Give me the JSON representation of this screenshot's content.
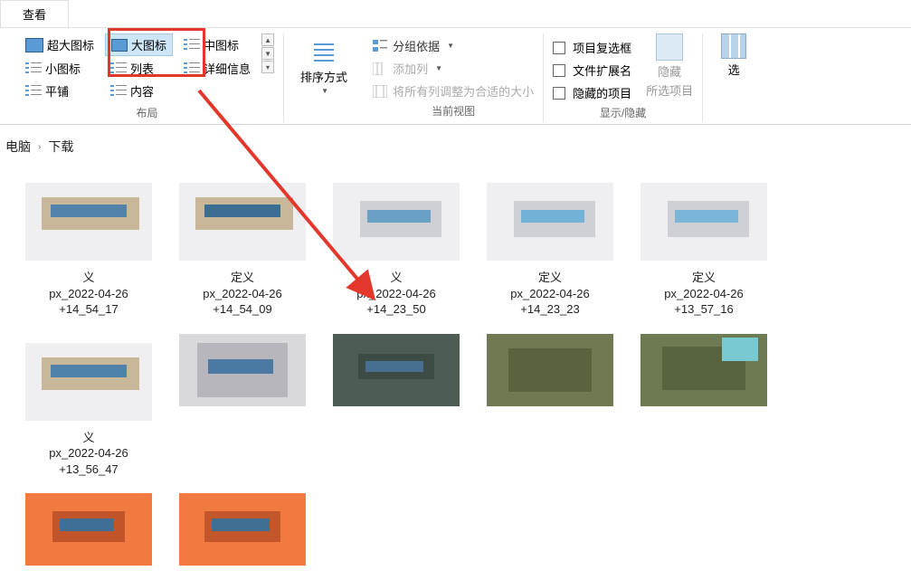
{
  "tabs": {
    "view": "查看"
  },
  "ribbon": {
    "layout": {
      "extra_large": "超大图标",
      "large": "大图标",
      "medium": "中图标",
      "small": "小图标",
      "list": "列表",
      "details": "详细信息",
      "tiles": "平铺",
      "content": "内容",
      "group_label": "布局"
    },
    "sort": {
      "label": "排序方式"
    },
    "view": {
      "group_by": "分组依据",
      "add_column": "添加列",
      "autofit": "将所有列调整为合适的大小",
      "group_label": "当前视图"
    },
    "showhide": {
      "checkboxes": "项目复选框",
      "extensions": "文件扩展名",
      "hidden_items": "隐藏的项目",
      "hide_selected_l1": "隐藏",
      "hide_selected_l2": "所选项目",
      "group_label": "显示/隐藏"
    },
    "options": {
      "label": "选"
    }
  },
  "breadcrumb": {
    "root": "电脑",
    "current": "下载"
  },
  "files": [
    {
      "l1": "义",
      "l2": "px_2022-04-26",
      "l3": "+14_54_17"
    },
    {
      "l1": "定义",
      "l2": "px_2022-04-26",
      "l3": "+14_54_09"
    },
    {
      "l1": "义",
      "l2": "px_2022-04-26",
      "l3": "+14_23_50"
    },
    {
      "l1": "定义",
      "l2": "px_2022-04-26",
      "l3": "+14_23_23"
    },
    {
      "l1": "定义",
      "l2": "px_2022-04-26",
      "l3": "+13_57_16"
    },
    {
      "l1": "义",
      "l2": "px_2022-04-26",
      "l3": "+13_56_47"
    }
  ]
}
